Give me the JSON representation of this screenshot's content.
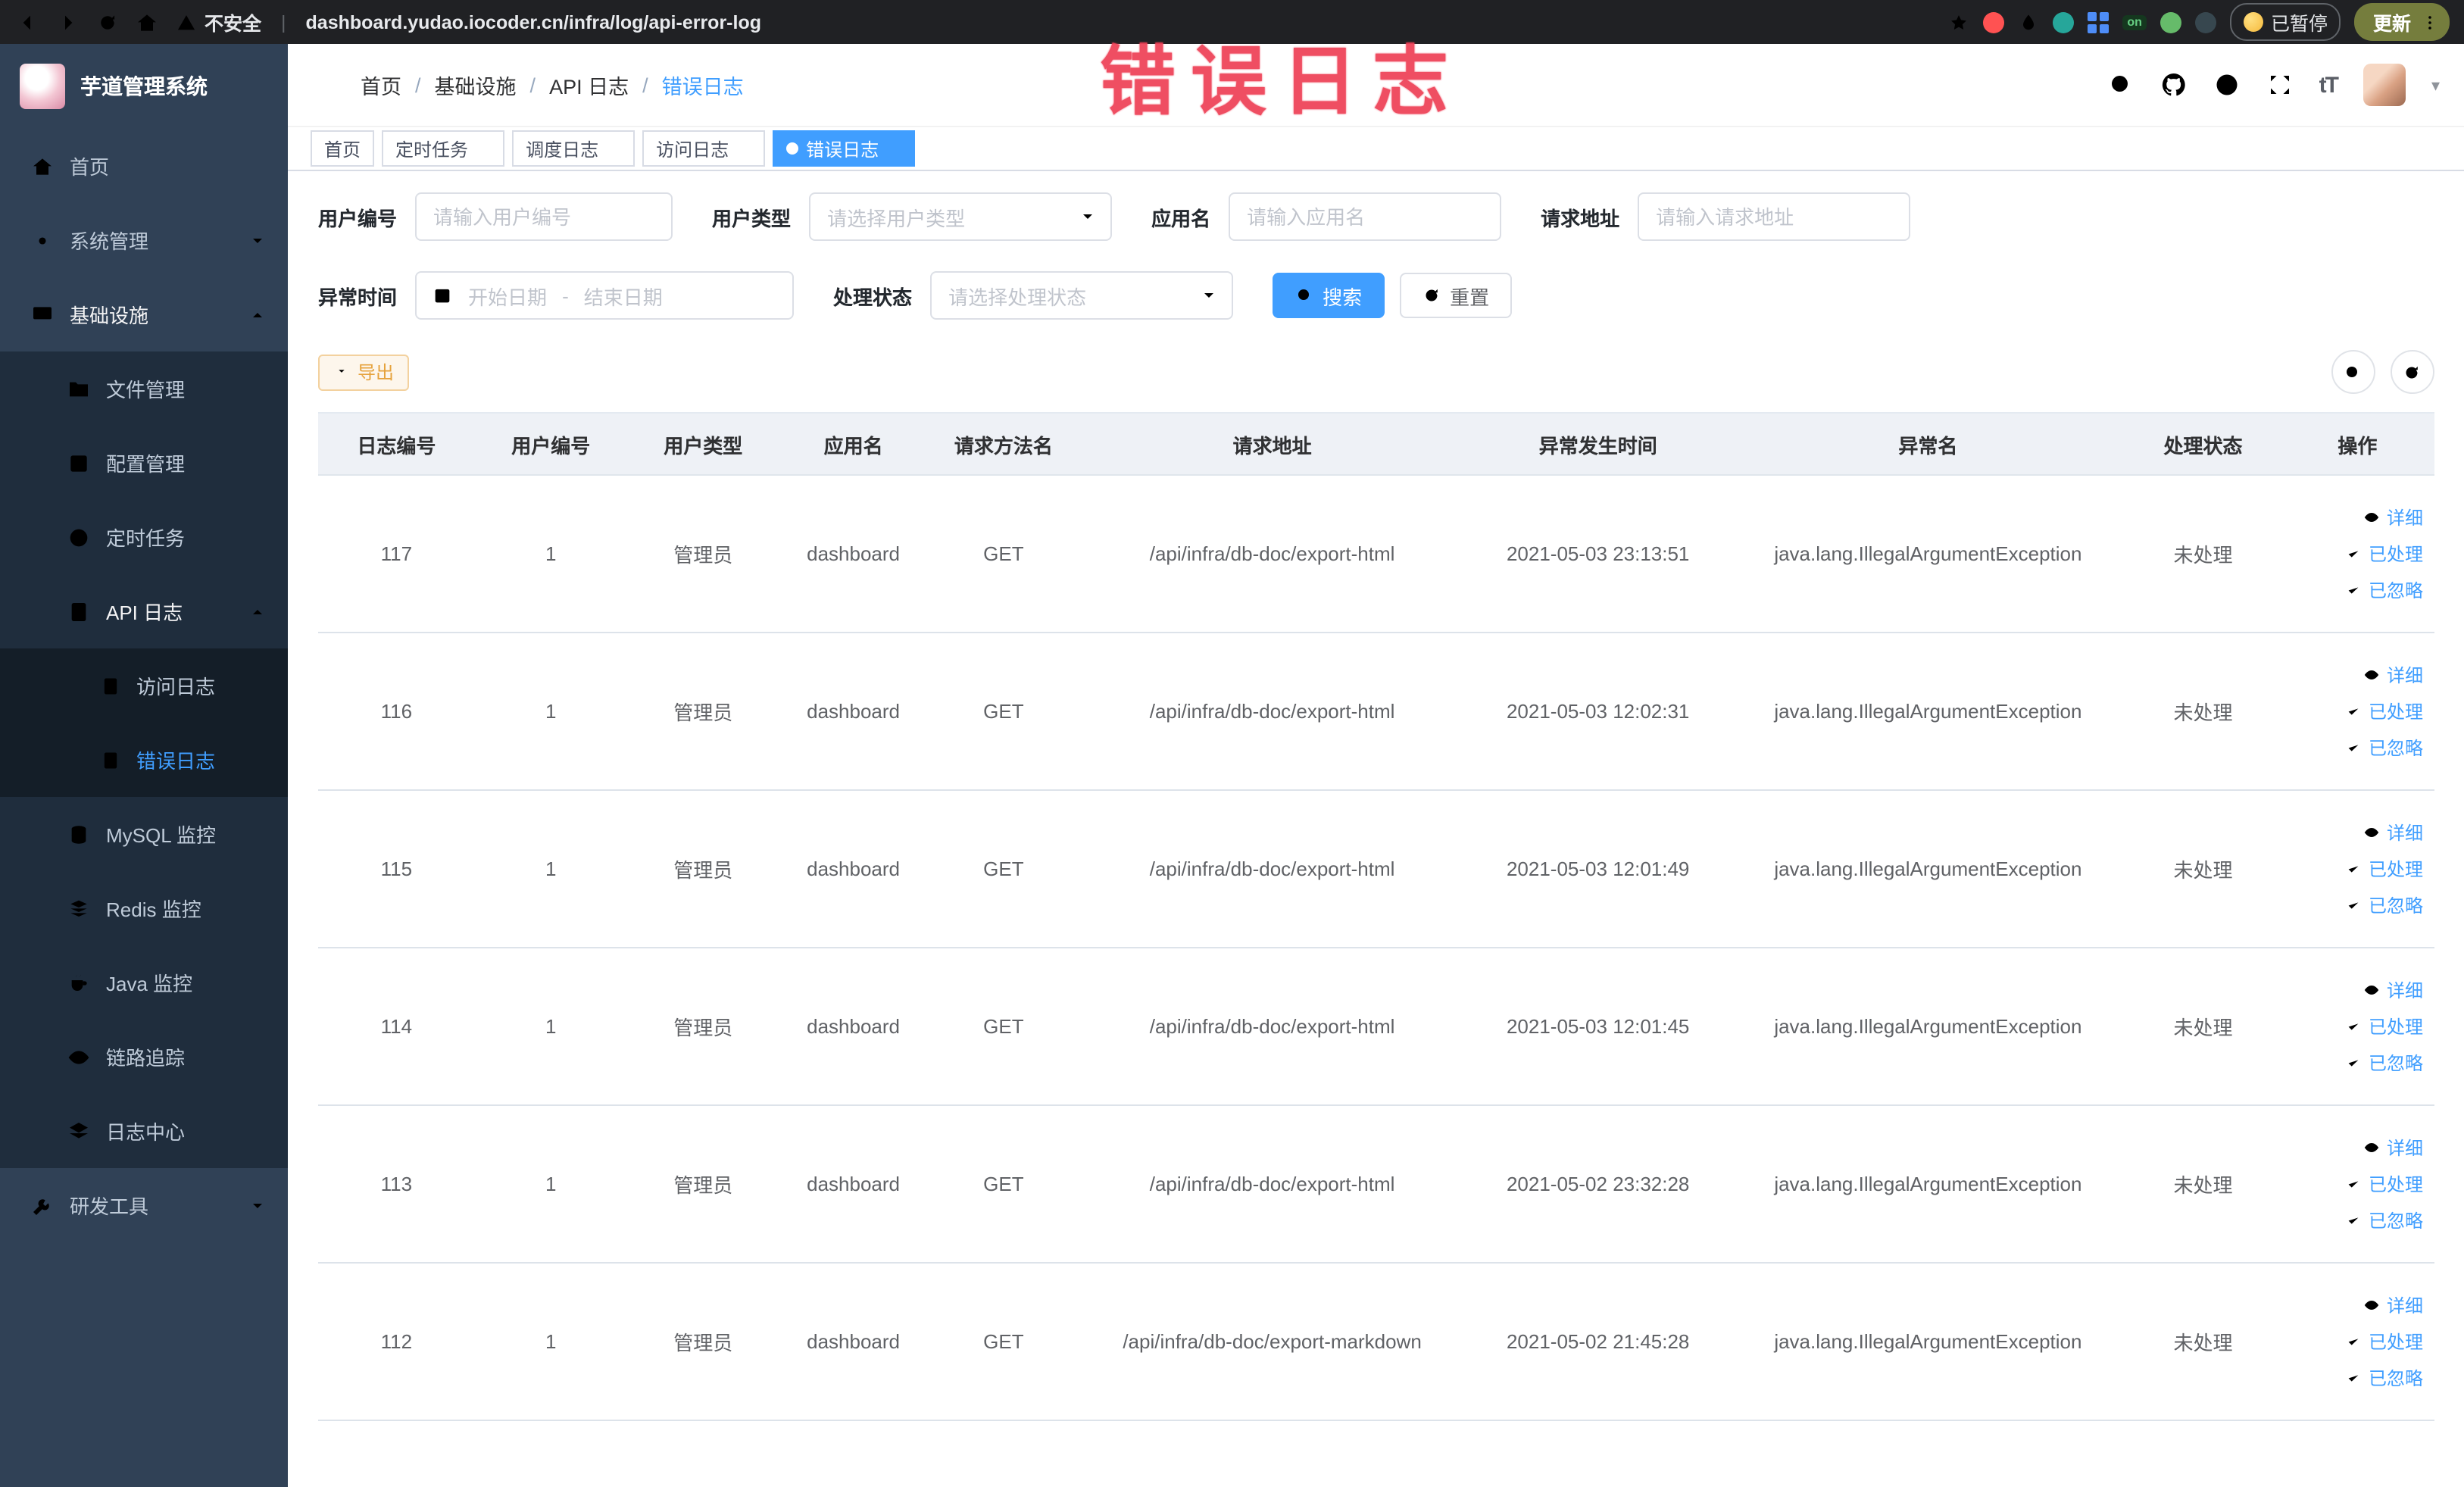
{
  "colors": {
    "primary": "#409eff",
    "annotation_red": "#ee3f55",
    "sidebar_bg": "#304156",
    "table_header_bg": "#eef1f6"
  },
  "icons": {
    "font_size_glyph": "tT",
    "caret_glyph": "▾",
    "dots_glyph": "⋮"
  },
  "browser": {
    "security_text": "不安全",
    "url": "dashboard.yudao.iocoder.cn/infra/log/api-error-log",
    "extension_on_text": "on",
    "paused_badge": "已暂停",
    "update_label": "更新"
  },
  "annotation": {
    "text": "错误日志"
  },
  "sidebar": {
    "logo_title": "芋道管理系统",
    "menu": [
      {
        "label": "首页"
      },
      {
        "label": "系统管理"
      },
      {
        "label": "基础设施"
      },
      {
        "label": "文件管理"
      },
      {
        "label": "配置管理"
      },
      {
        "label": "定时任务"
      },
      {
        "label": "API 日志"
      },
      {
        "label": "访问日志"
      },
      {
        "label": "错误日志"
      },
      {
        "label": "MySQL 监控"
      },
      {
        "label": "Redis 监控"
      },
      {
        "label": "Java 监控"
      },
      {
        "label": "链路追踪"
      },
      {
        "label": "日志中心"
      },
      {
        "label": "研发工具"
      }
    ]
  },
  "header": {
    "separator": "/",
    "breadcrumb": [
      {
        "label": "首页"
      },
      {
        "label": "基础设施"
      },
      {
        "label": "API 日志"
      },
      {
        "label": "错误日志"
      }
    ]
  },
  "tabs": [
    {
      "label": "首页"
    },
    {
      "label": "定时任务"
    },
    {
      "label": "调度日志"
    },
    {
      "label": "访问日志"
    },
    {
      "label": "错误日志"
    }
  ],
  "filters": {
    "user_id": {
      "label": "用户编号",
      "placeholder": "请输入用户编号"
    },
    "user_type": {
      "label": "用户类型",
      "placeholder": "请选择用户类型"
    },
    "app_name": {
      "label": "应用名",
      "placeholder": "请输入应用名"
    },
    "request_url": {
      "label": "请求地址",
      "placeholder": "请输入请求地址"
    },
    "exception_time": {
      "label": "异常时间",
      "start_placeholder": "开始日期",
      "separator": "-",
      "end_placeholder": "结束日期"
    },
    "process_status": {
      "label": "处理状态",
      "placeholder": "请选择处理状态"
    },
    "search_label": "搜索",
    "reset_label": "重置"
  },
  "toolbar": {
    "export_label": "导出"
  },
  "table": {
    "columns": [
      "日志编号",
      "用户编号",
      "用户类型",
      "应用名",
      "请求方法名",
      "请求地址",
      "异常发生时间",
      "异常名",
      "处理状态",
      "操作"
    ],
    "actions": [
      {
        "label": "详细"
      },
      {
        "label": "已处理"
      },
      {
        "label": "已忽略"
      }
    ],
    "rows": [
      {
        "id": "117",
        "user_id": "1",
        "user_type": "管理员",
        "app": "dashboard",
        "method": "GET",
        "url": "/api/infra/db-doc/export-html",
        "time": "2021-05-03 23:13:51",
        "exception": "java.lang.IllegalArgumentException",
        "status": "未处理"
      },
      {
        "id": "116",
        "user_id": "1",
        "user_type": "管理员",
        "app": "dashboard",
        "method": "GET",
        "url": "/api/infra/db-doc/export-html",
        "time": "2021-05-03 12:02:31",
        "exception": "java.lang.IllegalArgumentException",
        "status": "未处理"
      },
      {
        "id": "115",
        "user_id": "1",
        "user_type": "管理员",
        "app": "dashboard",
        "method": "GET",
        "url": "/api/infra/db-doc/export-html",
        "time": "2021-05-03 12:01:49",
        "exception": "java.lang.IllegalArgumentException",
        "status": "未处理"
      },
      {
        "id": "114",
        "user_id": "1",
        "user_type": "管理员",
        "app": "dashboard",
        "method": "GET",
        "url": "/api/infra/db-doc/export-html",
        "time": "2021-05-03 12:01:45",
        "exception": "java.lang.IllegalArgumentException",
        "status": "未处理"
      },
      {
        "id": "113",
        "user_id": "1",
        "user_type": "管理员",
        "app": "dashboard",
        "method": "GET",
        "url": "/api/infra/db-doc/export-html",
        "time": "2021-05-02 23:32:28",
        "exception": "java.lang.IllegalArgumentException",
        "status": "未处理"
      },
      {
        "id": "112",
        "user_id": "1",
        "user_type": "管理员",
        "app": "dashboard",
        "method": "GET",
        "url": "/api/infra/db-doc/export-markdown",
        "time": "2021-05-02 21:45:28",
        "exception": "java.lang.IllegalArgumentException",
        "status": "未处理"
      }
    ]
  }
}
